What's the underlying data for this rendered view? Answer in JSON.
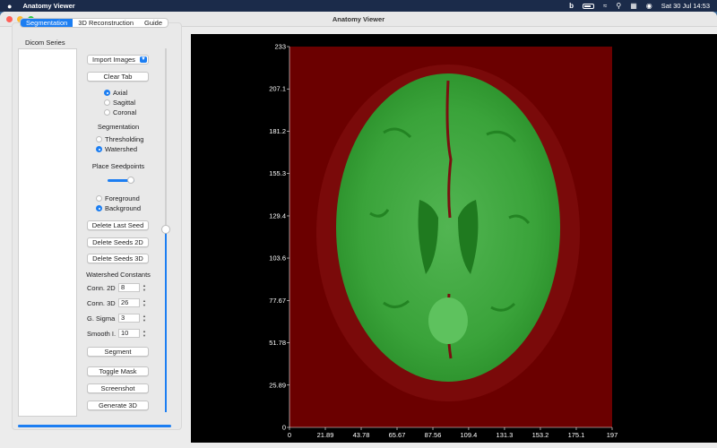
{
  "menubar": {
    "app_name": "Anatomy Viewer",
    "datetime": "Sat 30 Jul  14:53"
  },
  "window": {
    "title": "Anatomy Viewer"
  },
  "tabs": [
    {
      "label": "Segmentation",
      "active": true
    },
    {
      "label": "3D Reconstruction",
      "active": false
    },
    {
      "label": "Guide",
      "active": false
    }
  ],
  "panel": {
    "dicom_label": "Dicom Series",
    "import_label": "Import Images",
    "clear_label": "Clear Tab",
    "views": [
      {
        "label": "Axial",
        "selected": true
      },
      {
        "label": "Sagittal",
        "selected": false
      },
      {
        "label": "Coronal",
        "selected": false
      }
    ],
    "segmentation_heading": "Segmentation",
    "methods": [
      {
        "label": "Thresholding",
        "selected": false
      },
      {
        "label": "Watershed",
        "selected": true
      }
    ],
    "seedpoints_heading": "Place Seedpoints",
    "seed_slider_value": 1.0,
    "seed_types": [
      {
        "label": "Foreground",
        "selected": false
      },
      {
        "label": "Background",
        "selected": true
      }
    ],
    "delete_last": "Delete Last Seed",
    "delete_2d": "Delete Seeds 2D",
    "delete_3d": "Delete Seeds 3D",
    "watershed_heading": "Watershed Constants",
    "constants": [
      {
        "label": "Conn. 2D",
        "value": "8"
      },
      {
        "label": "Conn. 3D",
        "value": "26"
      },
      {
        "label": "G. Sigma",
        "value": "3"
      },
      {
        "label": "Smooth I.",
        "value": "10"
      }
    ],
    "segment_label": "Segment",
    "toggle_mask_label": "Toggle Mask",
    "screenshot_label": "Screenshot",
    "generate_label": "Generate 3D",
    "slice_slider_value": 0.49
  },
  "colors": {
    "accent": "#1c7ef2",
    "background_mask": "#6b0000",
    "foreground_mask": "#2fa02f"
  },
  "chart_data": {
    "type": "heatmap",
    "title": "",
    "xlabel": "",
    "ylabel": "",
    "xlim": [
      0,
      197
    ],
    "ylim": [
      0,
      233
    ],
    "x_ticks": [
      "0",
      "21.89",
      "43.78",
      "65.67",
      "87.56",
      "109.4",
      "131.3",
      "153.2",
      "175.1",
      "197"
    ],
    "y_ticks": [
      "0",
      "25.89",
      "51.78",
      "77.67",
      "103.6",
      "129.4",
      "155.3",
      "181.2",
      "207.1",
      "233"
    ]
  }
}
